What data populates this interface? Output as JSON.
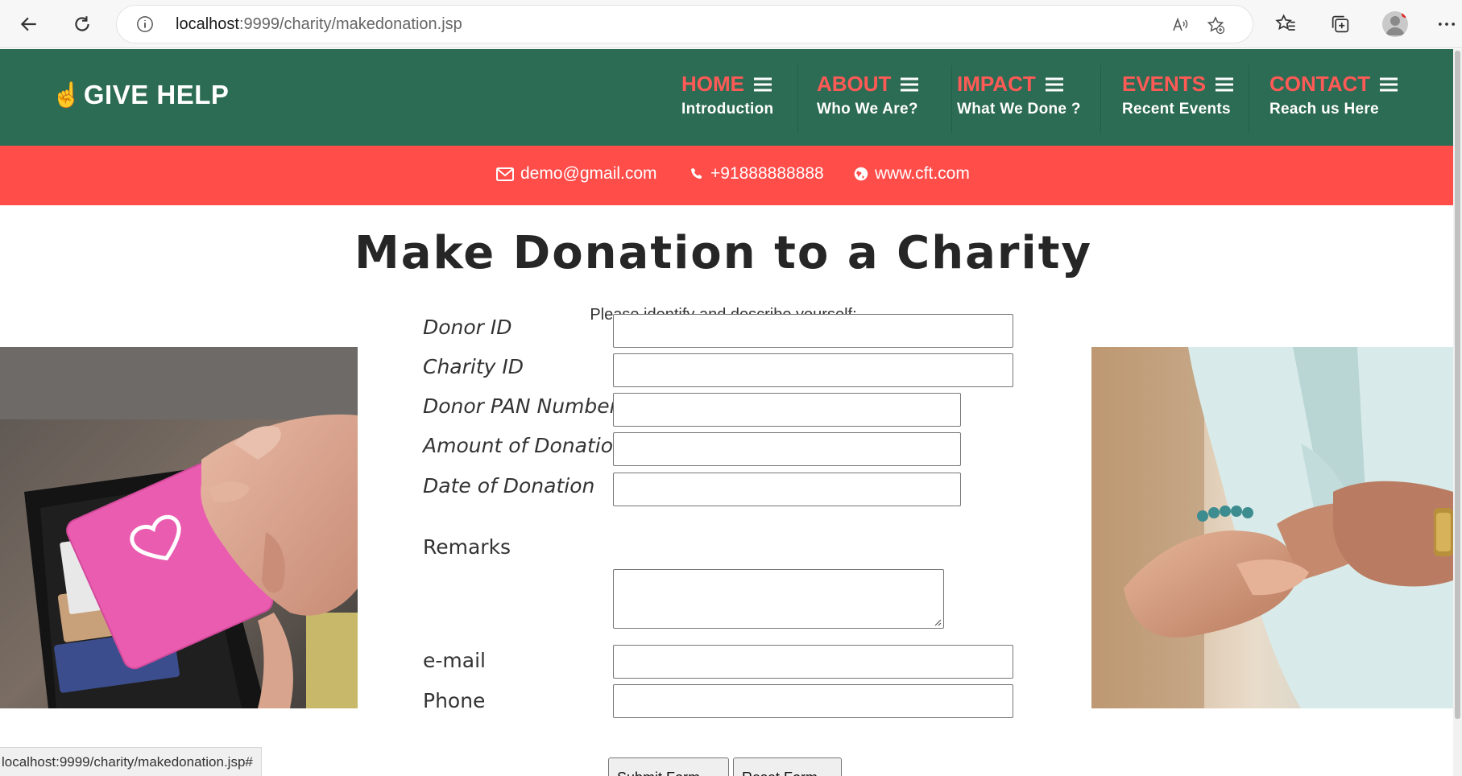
{
  "browser": {
    "url_host": "localhost",
    "url_rest": ":9999/charity/makedonation.jsp",
    "status_url": "localhost:9999/charity/makedonation.jsp#"
  },
  "header": {
    "logo_text": "GIVE HELP",
    "menu": [
      {
        "title": "HOME",
        "sub": "Introduction"
      },
      {
        "title": "ABOUT",
        "sub": "Who We Are?"
      },
      {
        "title": "IMPACT",
        "sub": "What We Done ?"
      },
      {
        "title": "EVENTS",
        "sub": "Recent Events"
      },
      {
        "title": "CONTACT",
        "sub": "Reach us Here"
      }
    ]
  },
  "contact": {
    "email": "demo@gmail.com",
    "phone": "+91888888888",
    "website": "www.cft.com"
  },
  "main": {
    "heading": "Make Donation to a Charity",
    "intro": "Please identify and describe yourself:",
    "fields": {
      "donor_id": {
        "label": "Donor ID",
        "value": ""
      },
      "charity_id": {
        "label": "Charity ID",
        "value": ""
      },
      "donor_pan": {
        "label": "Donor PAN Number",
        "value": ""
      },
      "amount": {
        "label": "Amount of Donation",
        "value": ""
      },
      "date": {
        "label": "Date of Donation",
        "value": ""
      },
      "remarks": {
        "label": "Remarks",
        "value": ""
      },
      "email": {
        "label": "e-mail",
        "value": ""
      },
      "phone": {
        "label": "Phone",
        "value": ""
      }
    },
    "submit_label": "Submit Form",
    "reset_label": "Reset Form"
  },
  "colors": {
    "header_bg": "#2c6b54",
    "accent_red": "#ff4d4a",
    "menu_title": "#ff5a55"
  }
}
